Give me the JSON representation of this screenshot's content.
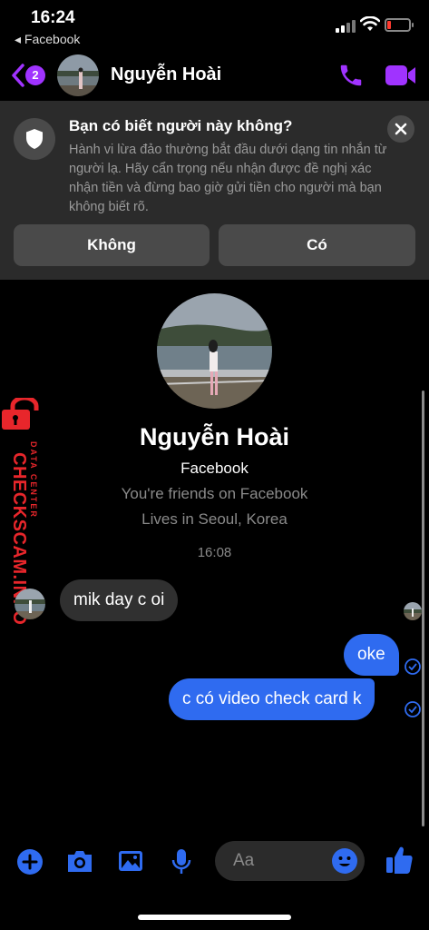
{
  "status_bar": {
    "time": "16:24",
    "back_app": "◂ Facebook",
    "battery_level": 0.18
  },
  "header": {
    "unread_count": "2",
    "contact_name": "Nguyễn Hoài"
  },
  "safety_banner": {
    "title": "Bạn có biết người này không?",
    "body": "Hành vi lừa đảo thường bắt đầu dưới dạng tin nhắn từ người lạ. Hãy cẩn trọng nếu nhận được đề nghị xác nhận tiền và đừng bao giờ gửi tiền cho người mà bạn không biết rõ.",
    "no_label": "Không",
    "yes_label": "Có"
  },
  "profile": {
    "name": "Nguyễn Hoài",
    "subtitle": "Facebook",
    "friends_text": "You're friends on Facebook",
    "lives_text": "Lives in Seoul, Korea"
  },
  "timestamp": "16:08",
  "watermark": {
    "brand": "CHECKSCAM.INFO",
    "tag": "DATA CENTER"
  },
  "messages": [
    {
      "direction": "incoming",
      "text": "mik day c oi"
    },
    {
      "direction": "outgoing",
      "text": "oke"
    },
    {
      "direction": "outgoing",
      "text": "c có video check card k"
    }
  ],
  "composer": {
    "placeholder": "Aa"
  },
  "colors": {
    "accent": "#a033ff",
    "bubble_out": "#2f6bf0",
    "bubble_in": "#303030",
    "banner_bg": "#2b2b2b",
    "watermark": "#e8262b"
  },
  "icons": [
    "back-chevron-icon",
    "phone-icon",
    "video-camera-icon",
    "shield-icon",
    "close-icon",
    "plus-icon",
    "camera-icon",
    "photo-icon",
    "microphone-icon",
    "emoji-icon",
    "thumbs-up-icon",
    "seen-check-icon"
  ]
}
